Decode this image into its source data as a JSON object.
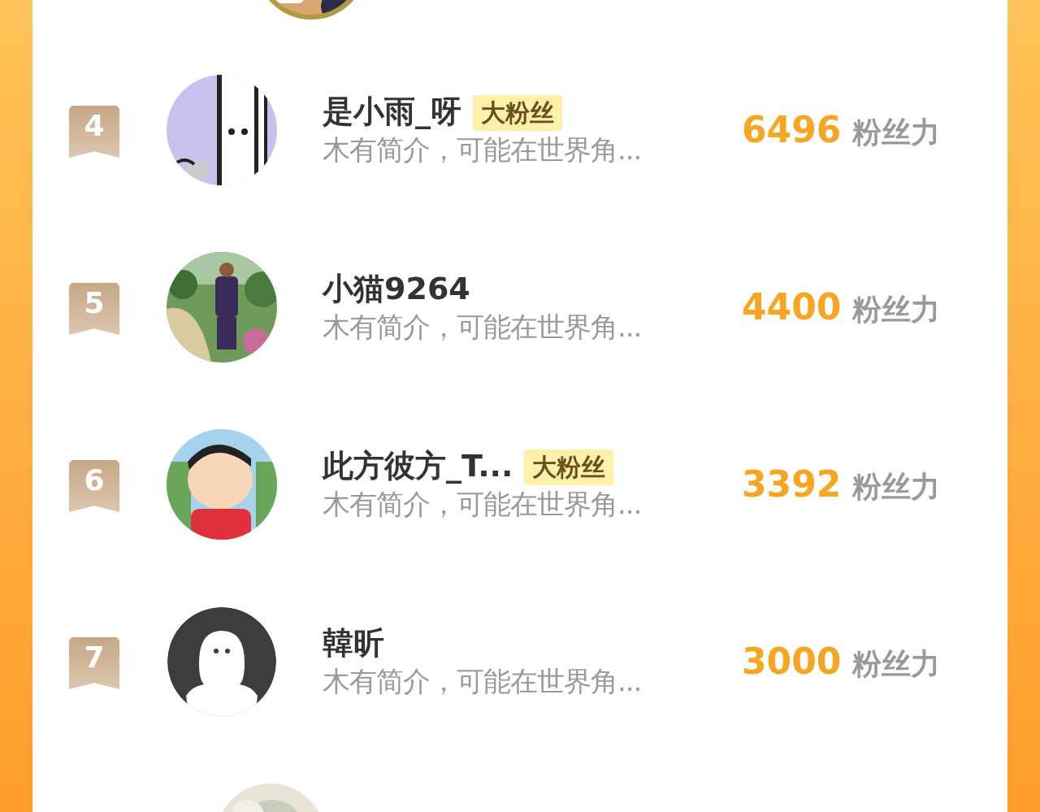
{
  "rows": [
    {
      "rank": "4",
      "name": "是小雨_呀",
      "badge": "大粉丝",
      "intro": "木有简介，可能在世界角...",
      "score": "6496",
      "score_unit": "粉丝力"
    },
    {
      "rank": "5",
      "name": "小猫9264",
      "intro": "木有简介，可能在世界角...",
      "score": "4400",
      "score_unit": "粉丝力"
    },
    {
      "rank": "6",
      "name": "此方彼方_T...",
      "badge": "大粉丝",
      "intro": "木有简介，可能在世界角...",
      "score": "3392",
      "score_unit": "粉丝力"
    },
    {
      "rank": "7",
      "avatar": {
        "kind": "default"
      },
      "name": "韓昕",
      "intro": "木有简介，可能在世界角...",
      "score": "3000",
      "score_unit": "粉丝力"
    }
  ]
}
